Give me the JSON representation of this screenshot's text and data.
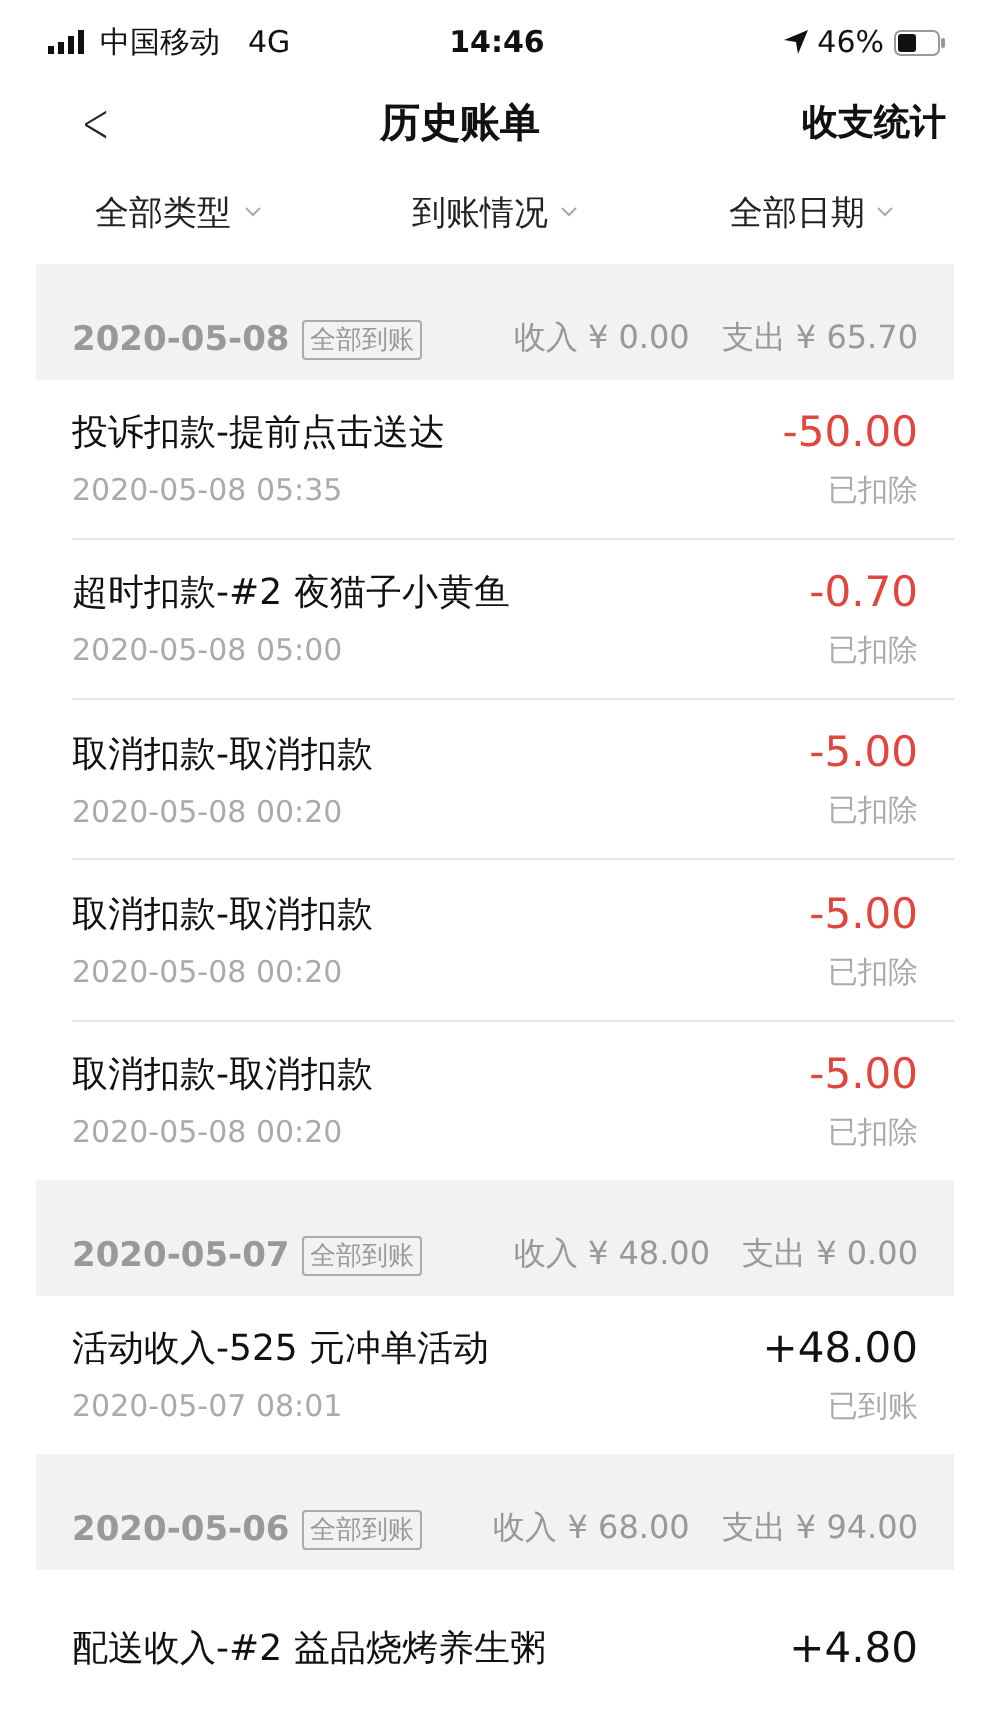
{
  "status_bar": {
    "carrier": "中国移动",
    "network": "4G",
    "time": "14:46",
    "battery": "46%"
  },
  "nav": {
    "back": "<",
    "title": "历史账单",
    "action": "收支统计"
  },
  "filters": [
    {
      "label": "全部类型"
    },
    {
      "label": "到账情况"
    },
    {
      "label": "全部日期"
    }
  ],
  "groups": [
    {
      "date": "2020-05-08",
      "tag": "全部到账",
      "income": "收入 ¥ 0.00",
      "expense": "支出 ¥ 65.70",
      "rows": [
        {
          "title": "投诉扣款-提前点击送达",
          "time": "2020-05-08 05:35",
          "amount": "-50.00",
          "kind": "debit",
          "status": "已扣除"
        },
        {
          "title": "超时扣款-#2 夜猫子小黄鱼",
          "time": "2020-05-08 05:00",
          "amount": "-0.70",
          "kind": "debit",
          "status": "已扣除"
        },
        {
          "title": "取消扣款-取消扣款",
          "time": "2020-05-08 00:20",
          "amount": "-5.00",
          "kind": "debit",
          "status": "已扣除"
        },
        {
          "title": "取消扣款-取消扣款",
          "time": "2020-05-08 00:20",
          "amount": "-5.00",
          "kind": "debit",
          "status": "已扣除"
        },
        {
          "title": "取消扣款-取消扣款",
          "time": "2020-05-08 00:20",
          "amount": "-5.00",
          "kind": "debit",
          "status": "已扣除"
        }
      ]
    },
    {
      "date": "2020-05-07",
      "tag": "全部到账",
      "income": "收入 ¥ 48.00",
      "expense": "支出 ¥ 0.00",
      "rows": [
        {
          "title": "活动收入-525 元冲单活动",
          "time": "2020-05-07 08:01",
          "amount": "+48.00",
          "kind": "credit",
          "status": "已到账"
        }
      ]
    },
    {
      "date": "2020-05-06",
      "tag": "全部到账",
      "income": "收入 ¥ 68.00",
      "expense": "支出 ¥ 94.00",
      "rows": [
        {
          "title": "配送收入-#2 益品烧烤养生粥",
          "amount": "+4.80",
          "kind": "credit"
        }
      ]
    }
  ]
}
